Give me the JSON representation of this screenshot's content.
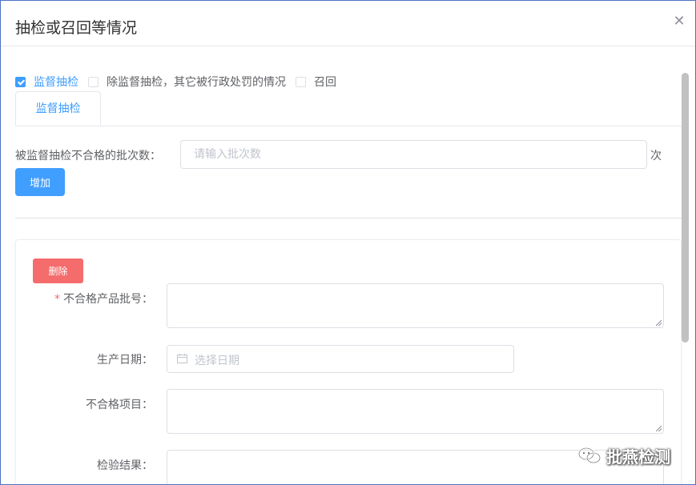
{
  "dialog": {
    "title": "抽检或召回等情况",
    "close_icon": "close-icon"
  },
  "checkboxes": [
    {
      "label": "监督抽检",
      "checked": true
    },
    {
      "label": "除监督抽检，其它被行政处罚的情况",
      "checked": false
    },
    {
      "label": "召回",
      "checked": false
    }
  ],
  "tabs": [
    {
      "label": "监督抽检",
      "active": true
    }
  ],
  "batch_count": {
    "label": "被监督抽检不合格的批次数：",
    "placeholder": "请输入批次数",
    "value": "",
    "unit": "次"
  },
  "add_button": "增加",
  "record": {
    "delete_button": "删除",
    "fields": {
      "batch_no": {
        "label": "不合格产品批号：",
        "required_mark": "*",
        "value": ""
      },
      "production_date": {
        "label": "生产日期：",
        "placeholder": "选择日期",
        "icon": "calendar-icon"
      },
      "failed_items": {
        "label": "不合格项目：",
        "value": ""
      },
      "result": {
        "label": "检验结果：",
        "value": ""
      }
    }
  },
  "watermark": "批燕检测",
  "colors": {
    "primary": "#409eff",
    "danger": "#f56c6c",
    "border": "#dcdfe6",
    "frame": "#4a72c4"
  }
}
